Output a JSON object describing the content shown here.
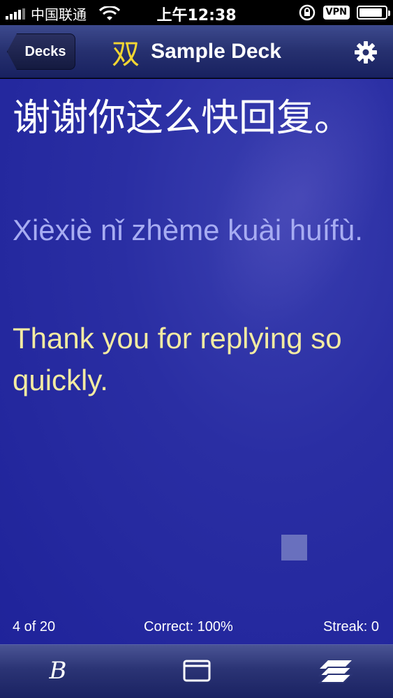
{
  "status_bar": {
    "carrier": "中国联通",
    "time": "上午12:38",
    "vpn": "VPN",
    "signal_bars": 4,
    "icons": [
      "signal-icon",
      "wifi-icon",
      "rotation-lock-icon",
      "vpn-badge",
      "battery-icon"
    ]
  },
  "nav": {
    "back_label": "Decks",
    "logo": "双",
    "title": "Sample Deck",
    "settings_icon": "gear-icon"
  },
  "card": {
    "hanzi": "谢谢你这么快回复。",
    "pinyin": "Xièxiè nǐ zhème kuài huífù.",
    "english": "Thank you for replying so quickly."
  },
  "stats": {
    "count": "4 of 20",
    "correct": "Correct: 100%",
    "streak": "Streak: 0"
  },
  "toolbar": {
    "b_button": "B",
    "icons": [
      "b-icon",
      "card-icon",
      "stack-icon"
    ]
  },
  "colors": {
    "hanzi": "#ffffff",
    "pinyin": "#a7acf2",
    "english": "#f3eba2",
    "logo": "#f2d632",
    "card_bg": "#2a2ea3"
  }
}
